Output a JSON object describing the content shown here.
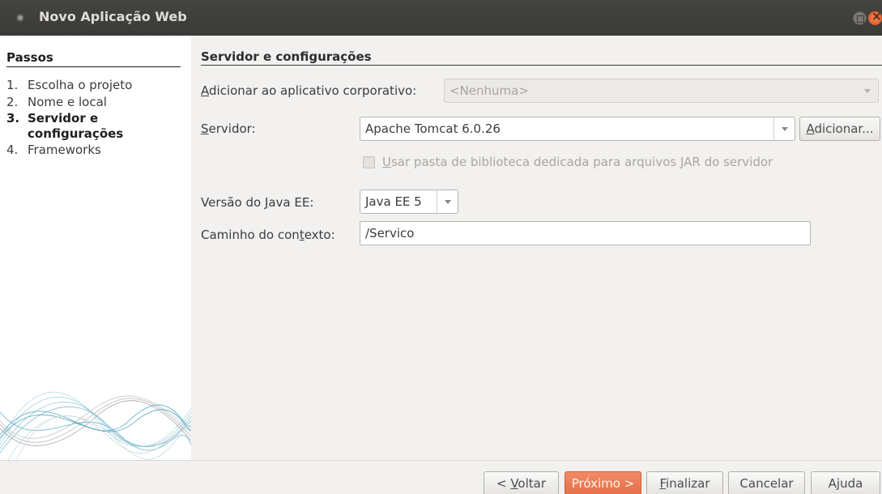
{
  "window": {
    "title": "Novo Aplicação Web"
  },
  "steps": {
    "heading": "Passos",
    "items": [
      {
        "num": "1.",
        "label": "Escolha o projeto",
        "current": false
      },
      {
        "num": "2.",
        "label": "Nome e local",
        "current": false
      },
      {
        "num": "3.",
        "label": "Servidor e configurações",
        "current": true
      },
      {
        "num": "4.",
        "label": "Frameworks",
        "current": false
      }
    ]
  },
  "panel": {
    "title": "Servidor e configurações",
    "enterprise_app": {
      "label_pre": "",
      "label_mnemonic": "A",
      "label_post": "dicionar ao aplicativo corporativo:",
      "value": "<Nenhuma>"
    },
    "server": {
      "label_mnemonic": "S",
      "label_post": "ervidor:",
      "value": "Apache Tomcat 6.0.26",
      "add_pre": "",
      "add_mnemonic": "A",
      "add_post": "dicionar..."
    },
    "dedicated_lib": {
      "label_mnemonic": "U",
      "label_post": "sar pasta de biblioteca dedicada para arquivos JAR do servidor",
      "checked": false
    },
    "java_ee": {
      "label_pre": "Versão do ",
      "label_mnemonic": "J",
      "label_post": "ava EE:",
      "value": "Java EE 5"
    },
    "context_path": {
      "label_pre": "Caminho do con",
      "label_mnemonic": "t",
      "label_post": "exto:",
      "value": "/Servico"
    }
  },
  "buttons": {
    "back": {
      "pre": "< ",
      "mnemonic": "V",
      "post": "oltar"
    },
    "next": {
      "label": "Próximo >"
    },
    "finish": {
      "mnemonic": "F",
      "post": "inalizar"
    },
    "cancel": {
      "label": "Cancelar"
    },
    "help": {
      "label": "Ajuda"
    }
  }
}
